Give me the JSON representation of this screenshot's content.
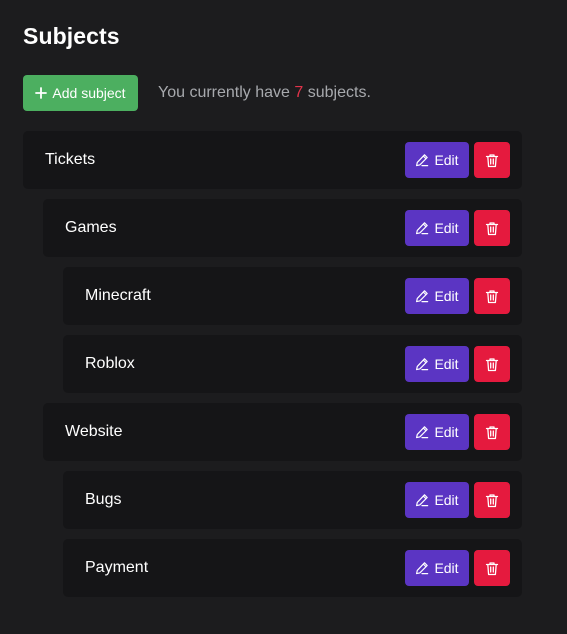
{
  "page": {
    "title": "Subjects"
  },
  "toolbar": {
    "add_label": "Add subject",
    "count_prefix": "You currently have ",
    "count_value": "7",
    "count_suffix": " subjects."
  },
  "subjects": [
    {
      "label": "Tickets",
      "depth": 0
    },
    {
      "label": "Games",
      "depth": 1
    },
    {
      "label": "Minecraft",
      "depth": 2
    },
    {
      "label": "Roblox",
      "depth": 2
    },
    {
      "label": "Website",
      "depth": 1
    },
    {
      "label": "Bugs",
      "depth": 2
    },
    {
      "label": "Payment",
      "depth": 2
    }
  ],
  "row_actions": {
    "edit_label": "Edit",
    "edit_icon": "pencil-icon",
    "delete_icon": "trash-icon"
  },
  "colors": {
    "background": "#1c1c1e",
    "row": "#151517",
    "add_button": "#4caf60",
    "edit_button": "#5b35c3",
    "delete_button": "#e51a3e",
    "count_highlight": "#e2334a"
  }
}
